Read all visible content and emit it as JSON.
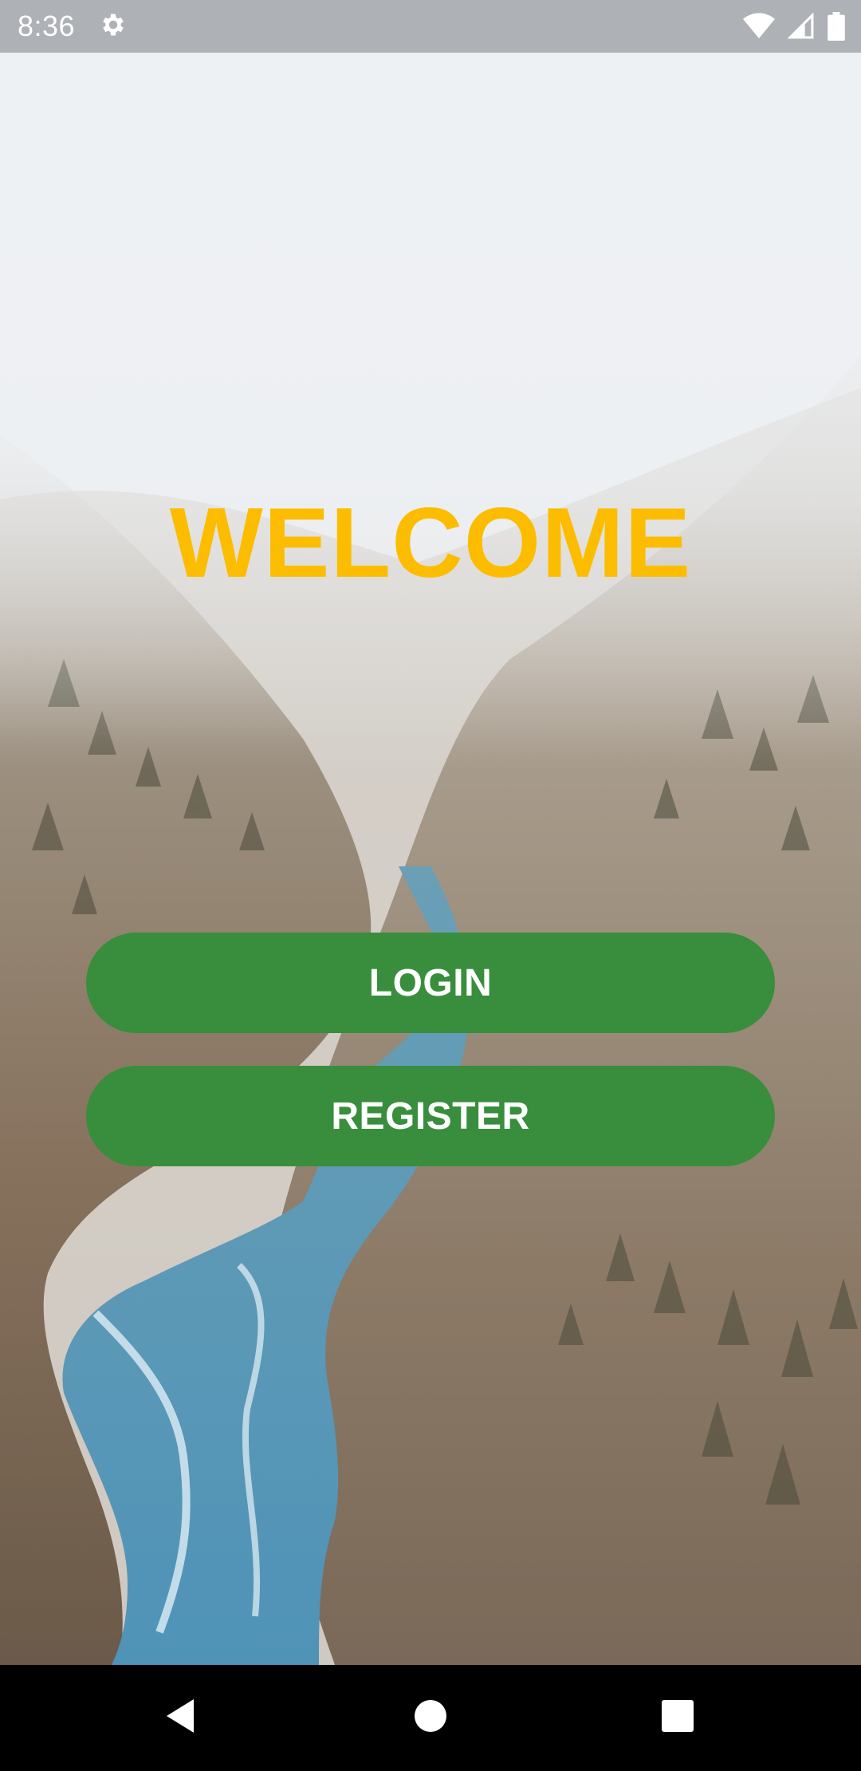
{
  "status_bar": {
    "time": "8:36",
    "icons": [
      "settings-gear-icon",
      "wifi-icon",
      "cell-signal-icon",
      "battery-icon"
    ]
  },
  "main": {
    "title": "WELCOME",
    "login_label": "LOGIN",
    "register_label": "REGISTER"
  },
  "nav_bar": {
    "icons": [
      "back-icon",
      "home-icon",
      "recents-icon"
    ]
  },
  "colors": {
    "title": "#fcbd00",
    "button": "#388e3c",
    "status_bar": "#aeb2b6"
  }
}
